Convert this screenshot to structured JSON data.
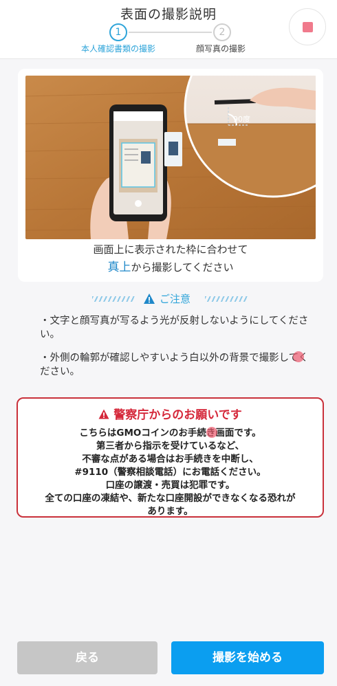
{
  "header": {
    "title": "表面の撮影説明",
    "steps": [
      {
        "number": "1",
        "label": "本人確認書類の撮影",
        "active": true
      },
      {
        "number": "2",
        "label": "顔写真の撮影",
        "active": false
      }
    ],
    "stop_icon": "stop-square-icon"
  },
  "photo": {
    "angle_label": "90度",
    "caption_line1": "画面上に表示された枠に合わせて",
    "caption_highlight": "真上",
    "caption_line2_rest": "から撮影してください"
  },
  "notice": {
    "label": "ご注意",
    "items": [
      "・文字と顔写真が写るよう光が反射しないようにしてください。",
      "・外側の輪郭が確認しやすいよう白以外の背景で撮影してください。"
    ]
  },
  "police": {
    "title": "警察庁からのお願いです",
    "lines": [
      "こちらはGMOコインのお手続き画面です。",
      "第三者から指示を受けているなど、",
      "不審な点がある場合はお手続きを中断し、",
      "#9110（警察相談電話）にお電話ください。",
      "口座の譲渡・売買は犯罪です。",
      "全ての口座の凍結や、新たな口座開設ができなくなる恐れが",
      "あります。"
    ]
  },
  "buttons": {
    "back": "戻る",
    "start": "撮影を始める"
  },
  "colors": {
    "accent": "#2ea4d9",
    "primary_button": "#0b9ef0",
    "disabled_button": "#c6c6c6",
    "alert_red": "#d5283a"
  }
}
